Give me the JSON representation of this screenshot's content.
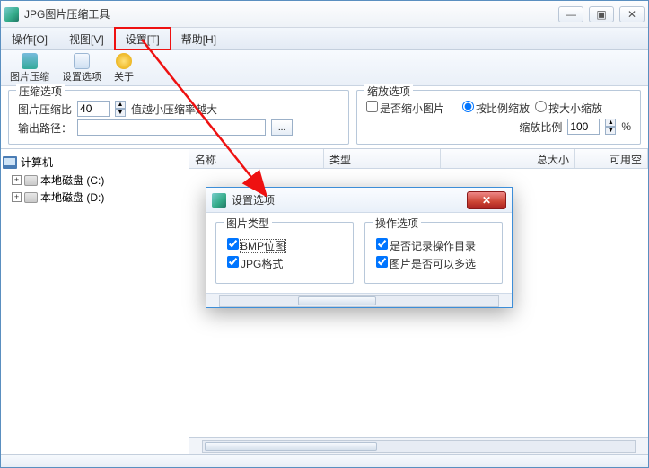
{
  "window": {
    "title": "JPG图片压缩工具"
  },
  "menus": {
    "operate": "操作[O]",
    "view": "视图[V]",
    "settings": "设置[T]",
    "help": "帮助[H]"
  },
  "toolbar": {
    "compress": "图片压缩",
    "options": "设置选项",
    "about": "关于"
  },
  "compress": {
    "group": "压缩选项",
    "ratio_label": "图片压缩比",
    "ratio_value": "40",
    "hint": "值越小压缩率越大",
    "path_label": "输出路径：",
    "path_value": "",
    "browse": "..."
  },
  "scale": {
    "group": "缩放选项",
    "enable": "是否缩小图片",
    "by_ratio": "按比例缩放",
    "by_size": "按大小缩放",
    "ratio_label": "缩放比例",
    "ratio_value": "100",
    "percent": "%"
  },
  "tree": {
    "root": "计算机",
    "drives": [
      "本地磁盘 (C:)",
      "本地磁盘 (D:)"
    ]
  },
  "columns": {
    "name": "名称",
    "type": "类型",
    "total": "总大小",
    "free": "可用空"
  },
  "dialog": {
    "title": "设置选项",
    "group_type": "图片类型",
    "bmp": "BMP位图",
    "jpg": "JPG格式",
    "group_op": "操作选项",
    "record_dir": "是否记录操作目录",
    "multi_select": "图片是否可以多选"
  },
  "glyphs": {
    "min": "—",
    "max": "▣",
    "close": "✕",
    "up": "▲",
    "down": "▼",
    "plus": "+"
  }
}
